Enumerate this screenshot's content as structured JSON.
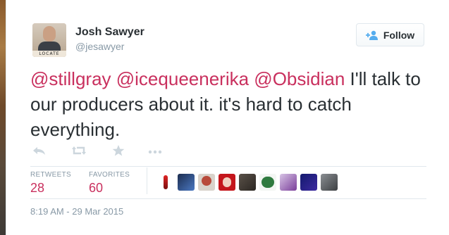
{
  "author": {
    "name": "Josh Sawyer",
    "handle": "@jesawyer",
    "avatar_tag": "LOCATE"
  },
  "follow_button": {
    "label": "Follow"
  },
  "tweet": {
    "mentions": [
      "@stillgray",
      "@icequeenerika",
      "@Obsidian"
    ],
    "text_after": " I'll talk to our producers about it. it's hard to catch everything."
  },
  "stats": {
    "retweets": {
      "label": "RETWEETS",
      "value": "28"
    },
    "favorites": {
      "label": "FAVORITES",
      "value": "60"
    }
  },
  "timestamp": "8:19 AM - 29 Mar 2015",
  "icons": [
    "reply-icon",
    "retweet-icon",
    "favorite-star-icon",
    "more-icon",
    "add-user-icon"
  ],
  "colors": {
    "mention": "#c9305e",
    "muted": "#8899a6",
    "text": "#292f33"
  }
}
